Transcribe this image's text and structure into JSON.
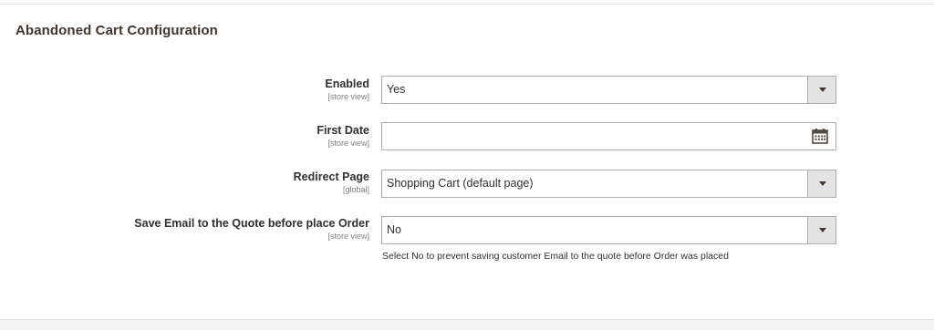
{
  "section": {
    "title": "Abandoned Cart Configuration"
  },
  "fields": [
    {
      "label": "Enabled",
      "scope": "[store view]",
      "value": "Yes",
      "type": "select"
    },
    {
      "label": "First Date",
      "scope": "[store view]",
      "value": "",
      "type": "date",
      "icon": "calendar-icon"
    },
    {
      "label": "Redirect Page",
      "scope": "[global]",
      "value": "Shopping Cart (default page)",
      "type": "select"
    },
    {
      "label": "Save Email to the Quote before place Order",
      "scope": "[store view]",
      "value": "No",
      "type": "select",
      "note": "Select No to prevent saving customer Email to the quote before Order was placed"
    }
  ]
}
